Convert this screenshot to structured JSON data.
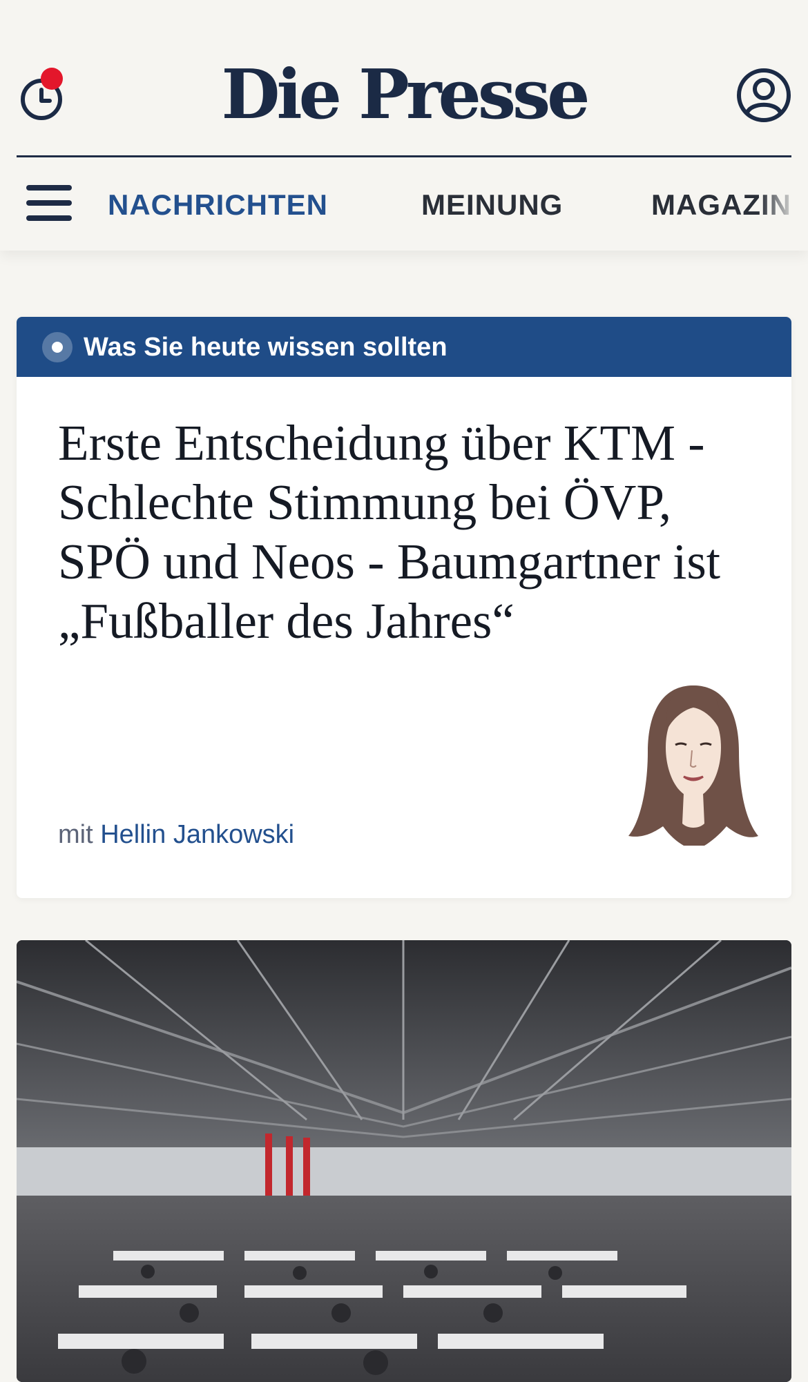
{
  "header": {
    "logo": "Die Presse",
    "icons": {
      "history": "clock-icon",
      "account": "user-icon",
      "menu": "hamburger-menu-icon"
    }
  },
  "nav": {
    "items": [
      {
        "label": "NACHRICHTEN",
        "active": true
      },
      {
        "label": "MEINUNG",
        "active": false
      },
      {
        "label": "MAGAZIN",
        "active": false
      }
    ]
  },
  "briefing": {
    "label": "Was Sie heute wissen sollten",
    "headline": "Erste Entscheidung über KTM - Schlechte Stimmung bei ÖVP, SPÖ und Neos - Baumgartner ist „Fußballer des Jahres“",
    "byline_prefix": "mit",
    "author": "Hellin Jankowski"
  },
  "colors": {
    "brand_navy": "#1b2a45",
    "accent_blue": "#1f4c87",
    "notification_red": "#e3172b",
    "background": "#f6f5f1"
  }
}
